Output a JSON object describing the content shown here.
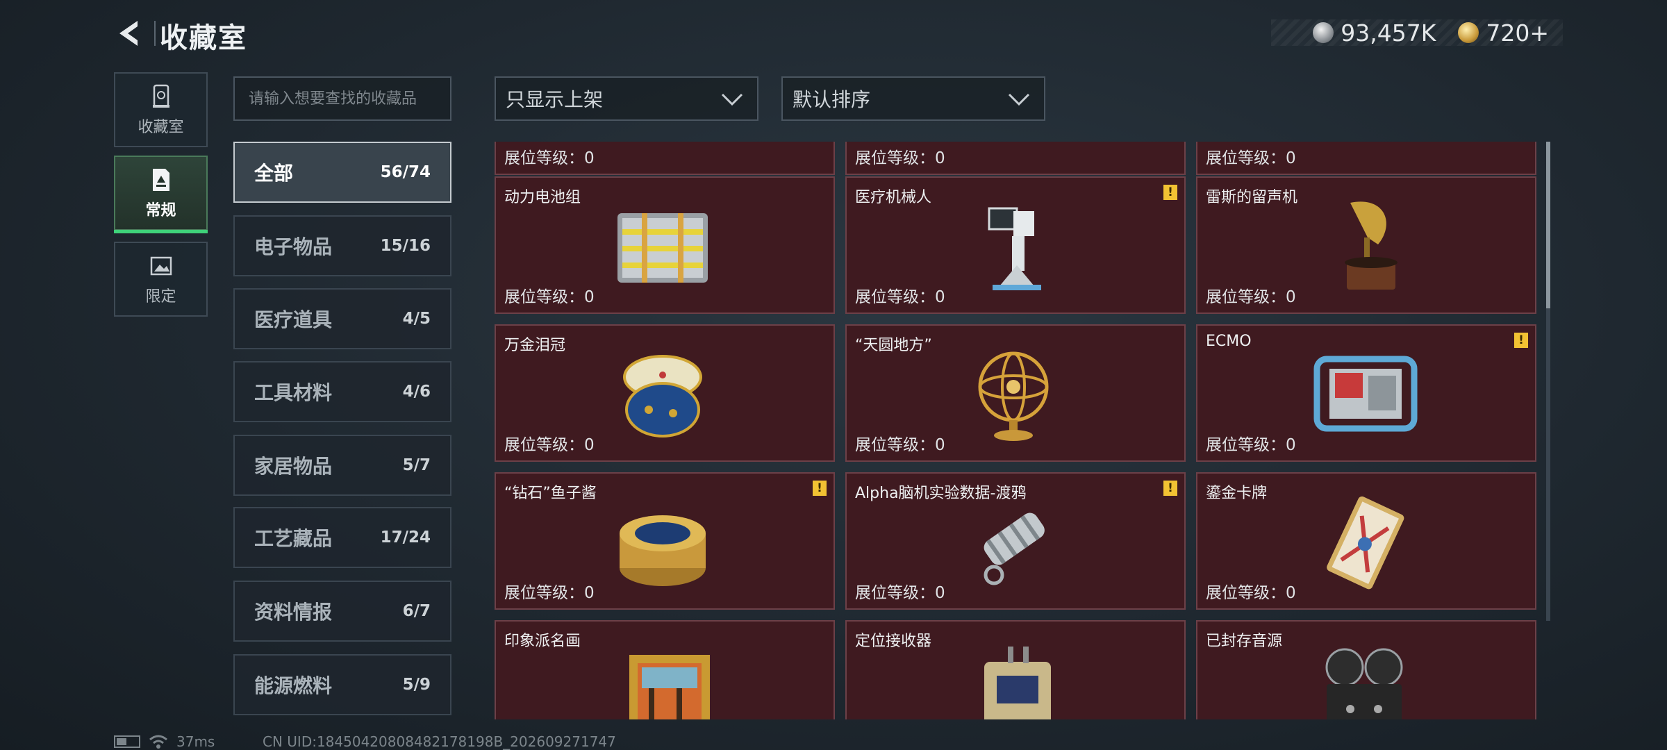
{
  "header": {
    "title": "收藏室"
  },
  "currency": {
    "silver": "93,457K",
    "gold": "720+"
  },
  "side_nav": [
    {
      "label": "收藏室",
      "active": false
    },
    {
      "label": "常规",
      "active": true
    },
    {
      "label": "限定",
      "active": false
    }
  ],
  "search": {
    "placeholder": "请输入想要查找的收藏品"
  },
  "categories": [
    {
      "name": "全部",
      "count": "56/74",
      "active": true
    },
    {
      "name": "电子物品",
      "count": "15/16"
    },
    {
      "name": "医疗道具",
      "count": "4/5"
    },
    {
      "name": "工具材料",
      "count": "4/6"
    },
    {
      "name": "家居物品",
      "count": "5/7"
    },
    {
      "name": "工艺藏品",
      "count": "17/24"
    },
    {
      "name": "资料情报",
      "count": "6/7"
    },
    {
      "name": "能源燃料",
      "count": "5/9"
    }
  ],
  "filters": {
    "display": "只显示上架",
    "sort": "默认排序"
  },
  "level_label": "展位等级：0",
  "items": [
    {
      "name": "",
      "warn": false,
      "icon": "partial-item"
    },
    {
      "name": "",
      "warn": false,
      "icon": "partial-item"
    },
    {
      "name": "",
      "warn": false,
      "icon": "partial-item"
    },
    {
      "name": "动力电池组",
      "warn": false,
      "icon": "battery-pack"
    },
    {
      "name": "医疗机械人",
      "warn": true,
      "icon": "medical-robot"
    },
    {
      "name": "雷斯的留声机",
      "warn": false,
      "icon": "gramophone"
    },
    {
      "name": "万金泪冠",
      "warn": false,
      "icon": "jeweled-egg"
    },
    {
      "name": "“天圆地方”",
      "warn": false,
      "icon": "armillary-sphere"
    },
    {
      "name": "ECMO",
      "warn": true,
      "icon": "ecmo-machine"
    },
    {
      "name": "“钻石”鱼子酱",
      "warn": true,
      "icon": "caviar-tin"
    },
    {
      "name": "Alpha脑机实验数据-渡鸦",
      "warn": true,
      "icon": "data-cylinder"
    },
    {
      "name": "鎏金卡牌",
      "warn": false,
      "icon": "gilded-card"
    },
    {
      "name": "印象派名画",
      "warn": false,
      "icon": "painting"
    },
    {
      "name": "定位接收器",
      "warn": false,
      "icon": "receiver"
    },
    {
      "name": "已封存音源",
      "warn": false,
      "icon": "reel-recorder"
    }
  ],
  "status": {
    "ping": "37ms",
    "uid": "CN UID:18450420808482178198B_202609271747"
  },
  "colors": {
    "card_bg": "#3f1a20",
    "accent_green": "#3fd27a",
    "warn": "#f2c233"
  }
}
